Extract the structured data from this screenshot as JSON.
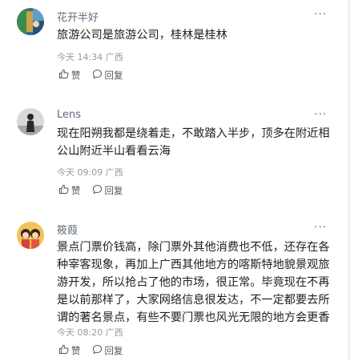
{
  "comments": [
    {
      "author": "花开半好",
      "lines": [
        "旅游公司是旅游公司，桂林是桂林"
      ],
      "time": "今天 14:34",
      "location": "广西",
      "like_label": "赞",
      "reply_label": "回复",
      "more": "···"
    },
    {
      "author": "Lens",
      "lines": [
        "现在阳朔我都是绕着走，不敢踏入半步，顶多在附近相",
        "公山附近半山看看云海"
      ],
      "time": "今天 09:09",
      "location": "广西",
      "like_label": "赞",
      "reply_label": "回复",
      "more": "···"
    },
    {
      "author": "筱葭",
      "lines": [
        "景点门票价钱高，除门票外其他消费也不低，还存在各",
        "种宰客现象，再加上广西其他地方的喀斯特地貌景观旅",
        "游开发，所以抢占了他的市场，很正常。毕竟现在不再",
        "是以前那样了，大家网络信息很发达，不一定都要去所",
        "谓的著名景点，有些不要门票也风光无限的地方会更香"
      ],
      "time": "今天 08:20",
      "location": "广西",
      "like_label": "赞",
      "reply_label": "回复",
      "more": "···"
    }
  ],
  "colors": {
    "name": "#5f6b7a",
    "meta": "#999999",
    "text": "#1f1f1f"
  }
}
